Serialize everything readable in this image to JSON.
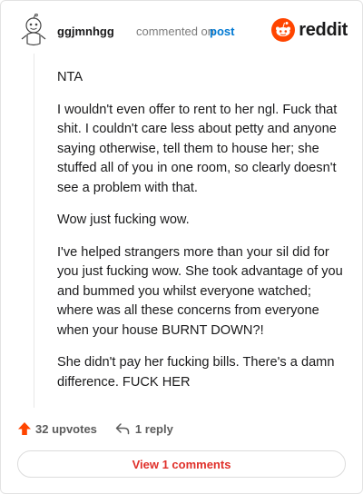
{
  "header": {
    "username": "ggjmnhgg",
    "commented_text": "commented on",
    "post_link": "post",
    "logo_text": "reddit",
    "logo_color": "#ff4500"
  },
  "comment": {
    "paragraphs": [
      "NTA",
      "I wouldn't even offer to rent to her ngl. Fuck that shit. I couldn't care less about petty and anyone saying otherwise, tell them to house her; she stuffed all of you in one room, so clearly doesn't see a problem with that.",
      "Wow just fucking wow.",
      "I've helped strangers more than your sil did for you just fucking wow. She took advantage of you and bummed you whilst everyone watched; where was all these concerns from everyone when your house BURNT DOWN?!",
      "She didn't pay her fucking bills. There's a damn difference. FUCK HER"
    ]
  },
  "actions": {
    "upvotes_label": "32 upvotes",
    "reply_label": "1 reply",
    "upvote_color": "#ff4500"
  },
  "footer": {
    "view_comments_label": "View 1 comments",
    "view_color": "#e0302a"
  }
}
